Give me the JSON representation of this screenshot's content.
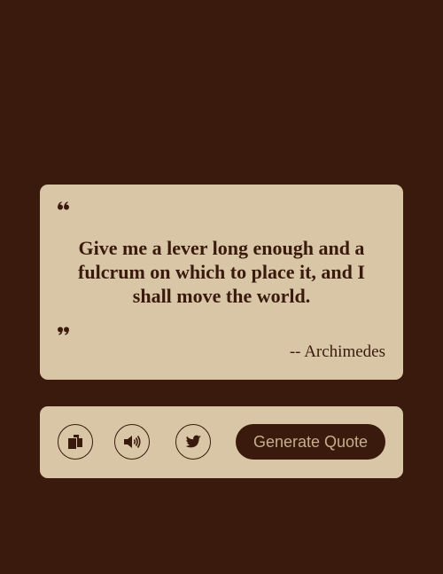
{
  "quote": {
    "text": "Give me a lever long enough and a fulcrum on which to place it, and I shall move the world.",
    "author": "-- Archimedes",
    "open_icon": "quote-left-icon",
    "close_icon": "quote-right-icon"
  },
  "controls": {
    "copy_icon": "copy-icon",
    "speak_icon": "speaker-icon",
    "tweet_icon": "twitter-icon",
    "generate_label": "Generate Quote"
  },
  "colors": {
    "background": "#3a1a0c",
    "card": "#d8c6a7",
    "button_text": "#c5ae8c"
  }
}
